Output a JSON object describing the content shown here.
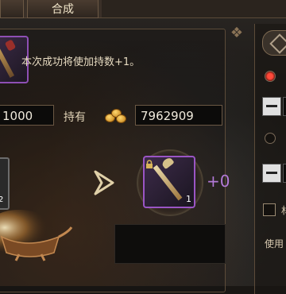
{
  "tabs": {
    "synthesis_label": "合成"
  },
  "description": "本次成功将使加持数+1。",
  "cost_value": "1000",
  "hold_label": "持有",
  "hold_value": "7962909",
  "source_item": {
    "count": "2"
  },
  "result_item": {
    "count": "1",
    "bonus": "+0"
  },
  "right_panel": {
    "option_label_partial": "材",
    "use_label": "使用"
  },
  "colors": {
    "rare_border": "#9a55c4",
    "bonus_text": "#b37ad8",
    "radio_active": "#ff4a3a"
  },
  "icons": [
    "gold-coin-icon",
    "lock-icon",
    "arrow-right-icon",
    "staff-icon",
    "diamond-icon"
  ]
}
